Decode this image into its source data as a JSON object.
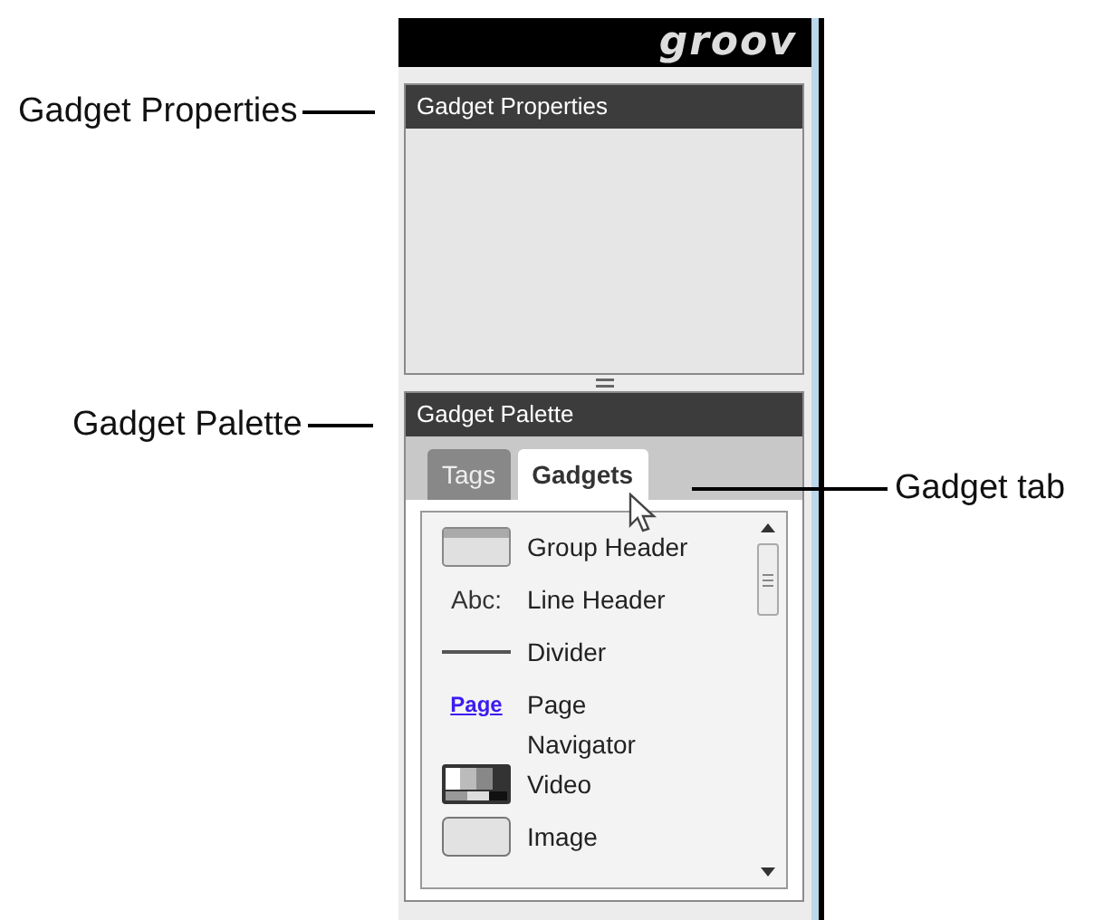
{
  "callouts": [
    {
      "text": "Gadget Properties"
    },
    {
      "text": "Gadget Palette"
    },
    {
      "text": "Gadget tab"
    }
  ],
  "header": {
    "logo": "groov"
  },
  "properties_panel": {
    "title": "Gadget Properties"
  },
  "palette_panel": {
    "title": "Gadget Palette",
    "tabs": [
      {
        "label": "Tags",
        "selected": false
      },
      {
        "label": "Gadgets",
        "selected": true
      }
    ],
    "items": [
      {
        "kind": "group-header",
        "label": "Group Header"
      },
      {
        "kind": "text",
        "icon_text": "Abc:",
        "label": "Line Header"
      },
      {
        "kind": "divider",
        "label": "Divider"
      },
      {
        "kind": "link",
        "icon_text": "Page",
        "label": "Page Navigator"
      },
      {
        "kind": "video",
        "label": "Video"
      },
      {
        "kind": "image",
        "label": "Image"
      }
    ]
  }
}
